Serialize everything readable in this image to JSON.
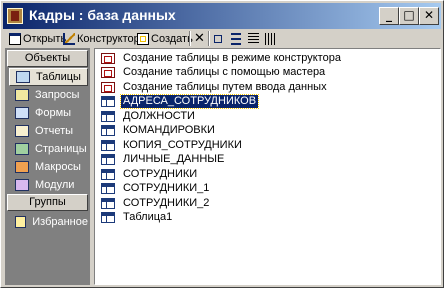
{
  "window": {
    "title": "Кадры : база данных",
    "controls": {
      "minimize": "_",
      "maximize": "□",
      "close": "✕"
    }
  },
  "toolbar": {
    "open_label": "Открыть",
    "design_label": "Конструктор",
    "create_label": "Создать",
    "delete_icon": "delete-icon",
    "view_icons": [
      "large-icons-view-icon",
      "small-icons-view-icon",
      "list-view-icon",
      "details-view-icon"
    ]
  },
  "objects": {
    "header": "Объекты",
    "items": [
      {
        "label": "Таблицы",
        "icon": "tables-icon",
        "selected": true
      },
      {
        "label": "Запросы",
        "icon": "queries-icon"
      },
      {
        "label": "Формы",
        "icon": "forms-icon"
      },
      {
        "label": "Отчеты",
        "icon": "reports-icon"
      },
      {
        "label": "Страницы",
        "icon": "pages-icon"
      },
      {
        "label": "Макросы",
        "icon": "macros-icon"
      },
      {
        "label": "Модули",
        "icon": "modules-icon"
      }
    ],
    "groups_header": "Группы",
    "groups": [
      {
        "label": "Избранное",
        "icon": "favorites-icon"
      }
    ]
  },
  "list": {
    "items": [
      {
        "label": "Создание таблицы в режиме конструктора",
        "icon": "wizard-icon"
      },
      {
        "label": "Создание таблицы с помощью мастера",
        "icon": "wizard-icon"
      },
      {
        "label": "Создание таблицы путем ввода данных",
        "icon": "wizard-icon"
      },
      {
        "label": "АДРЕСА_СОТРУДНИКОВ",
        "icon": "table-icon",
        "selected": true
      },
      {
        "label": "ДОЛЖНОСТИ",
        "icon": "table-icon"
      },
      {
        "label": "КОМАНДИРОВКИ",
        "icon": "table-icon"
      },
      {
        "label": "КОПИЯ_СОТРУДНИКИ",
        "icon": "table-icon"
      },
      {
        "label": "ЛИЧНЫЕ_ДАННЫЕ",
        "icon": "table-icon"
      },
      {
        "label": "СОТРУДНИКИ",
        "icon": "table-icon"
      },
      {
        "label": "СОТРУДНИКИ_1",
        "icon": "table-icon"
      },
      {
        "label": "СОТРУДНИКИ_2",
        "icon": "table-icon"
      },
      {
        "label": "Таблица1",
        "icon": "table-icon"
      }
    ]
  },
  "colors": {
    "titlebar_start": "#0a246a",
    "titlebar_end": "#a6caf0",
    "selection": "#0a246a",
    "sidebar": "#808080"
  }
}
